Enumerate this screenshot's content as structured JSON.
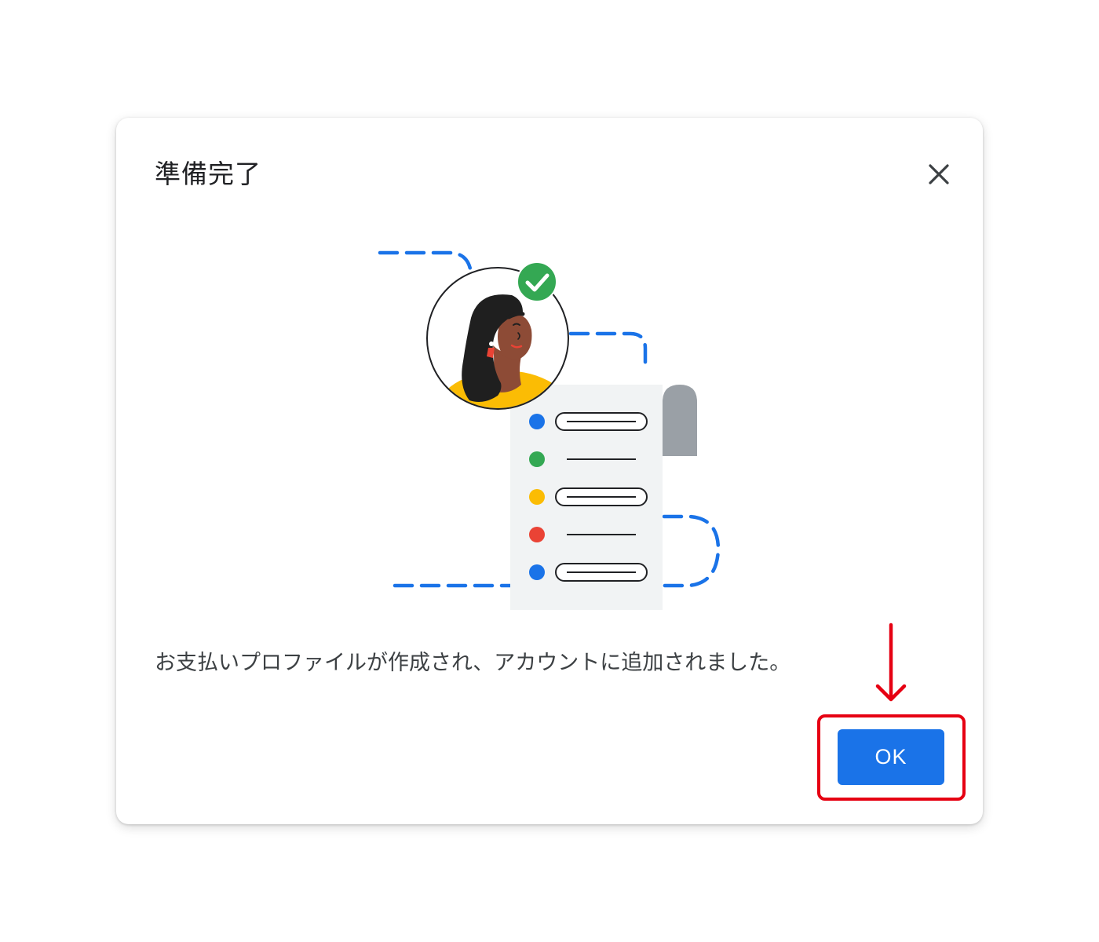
{
  "dialog": {
    "title": "準備完了",
    "message": "お支払いプロファイルが作成され、アカウントに追加されました。",
    "ok_label": "OK"
  },
  "icons": {
    "close": "close-icon",
    "check": "check-circle-icon",
    "annotation_arrow": "arrow-down-icon"
  },
  "colors": {
    "primary": "#1a73e8",
    "success": "#34a853",
    "warning": "#fbbc04",
    "error": "#ea4335",
    "annotation": "#e60012",
    "title_text": "#202124",
    "body_text": "#3c4043"
  }
}
